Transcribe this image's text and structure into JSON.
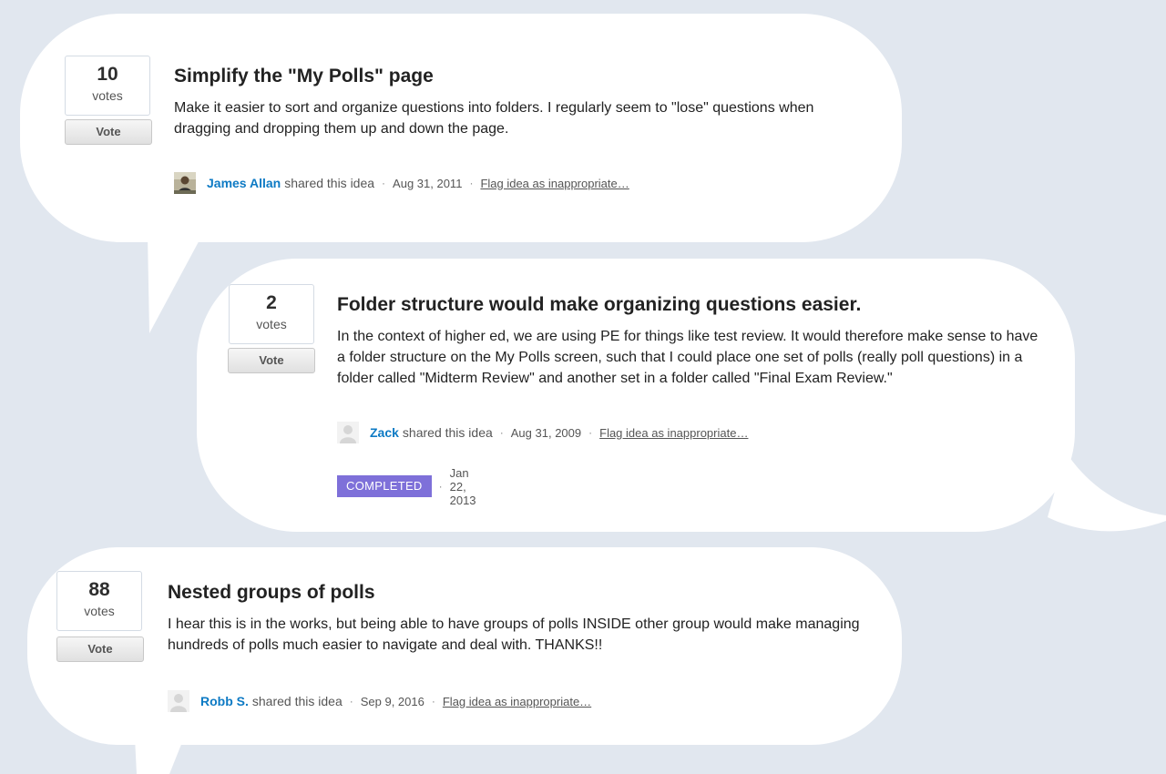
{
  "ideas": [
    {
      "votes": "10",
      "votes_label": "votes",
      "vote_button": "Vote",
      "title": "Simplify the \"My Polls\" page",
      "body": "Make it easier to sort and organize questions into folders. I regularly seem to \"lose\" questions when dragging and dropping them up and down the page.",
      "author": "James Allan",
      "shared_text": "shared this idea",
      "separator": "·",
      "date": "Aug 31, 2011",
      "flag_text": "Flag idea as inappropriate…",
      "avatar_icon": "user-photo-icon"
    },
    {
      "votes": "2",
      "votes_label": "votes",
      "vote_button": "Vote",
      "title": "Folder structure would make organizing questions easier.",
      "body": "In the context of higher ed, we are using PE for things like test review. It would therefore make sense to have a folder structure on the My Polls screen, such that I could place one set of polls (really poll questions) in a folder called \"Midterm Review\" and another set in a folder called \"Final Exam Review.\"",
      "author": "Zack",
      "shared_text": "shared this idea",
      "separator": "·",
      "date": "Aug 31, 2009",
      "flag_text": "Flag idea as inappropriate…",
      "avatar_icon": "default-avatar-icon",
      "status": "COMPLETED",
      "status_date": "Jan 22, 2013",
      "status_color": "#7e70d9"
    },
    {
      "votes": "88",
      "votes_label": "votes",
      "vote_button": "Vote",
      "title": "Nested groups of polls",
      "body": "I hear this is in the works, but being able to have groups of polls INSIDE other group would make managing hundreds of polls much easier to navigate and deal with. THANKS!!",
      "author": "Robb S.",
      "shared_text": "shared this idea",
      "separator": "·",
      "date": "Sep 9, 2016",
      "flag_text": "Flag idea as inappropriate…",
      "avatar_icon": "default-avatar-icon"
    }
  ],
  "colors": {
    "background": "#e1e7ef",
    "bubble": "#ffffff",
    "author_link": "#0d7ac4",
    "completed_badge": "#7e70d9"
  }
}
